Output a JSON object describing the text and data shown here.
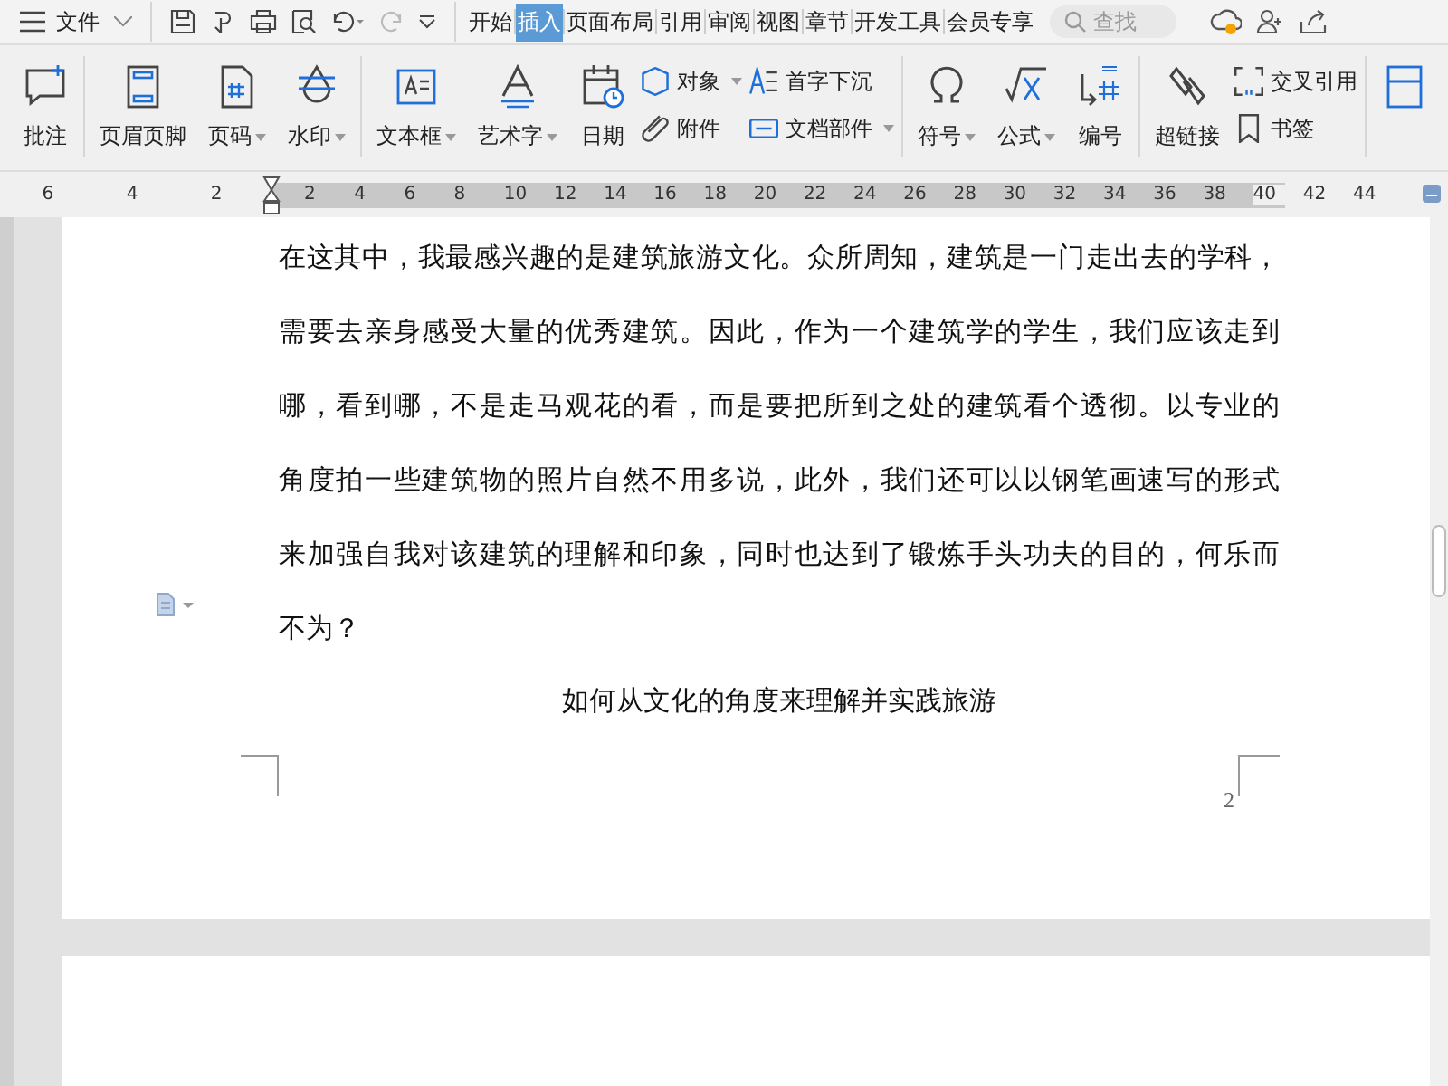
{
  "menu": {
    "file_label": "文件",
    "tabs": [
      {
        "label": "开始",
        "selected": false
      },
      {
        "label": "插入",
        "selected": true
      },
      {
        "label": "页面布局",
        "selected": false
      },
      {
        "label": "引用",
        "selected": false
      },
      {
        "label": "审阅",
        "selected": false
      },
      {
        "label": "视图",
        "selected": false
      },
      {
        "label": "章节",
        "selected": false
      },
      {
        "label": "开发工具",
        "selected": false
      },
      {
        "label": "会员专享",
        "selected": false
      }
    ],
    "search": {
      "placeholder": "查找"
    }
  },
  "ribbon": {
    "groups": [
      {
        "items": [
          {
            "kind": "large",
            "label": "批注",
            "dropdown": false
          }
        ]
      },
      {
        "items": [
          {
            "kind": "large",
            "label": "页眉页脚",
            "dropdown": false
          },
          {
            "kind": "large",
            "label": "页码",
            "dropdown": true
          },
          {
            "kind": "large",
            "label": "水印",
            "dropdown": true
          }
        ]
      },
      {
        "items": [
          {
            "kind": "large",
            "label": "文本框",
            "dropdown": true
          },
          {
            "kind": "large",
            "label": "艺术字",
            "dropdown": true
          },
          {
            "kind": "large",
            "label": "日期",
            "dropdown": false
          },
          {
            "kind": "small",
            "label": "对象",
            "dropdown": true
          },
          {
            "kind": "small",
            "label": "附件",
            "dropdown": false
          },
          {
            "kind": "small",
            "label": "首字下沉",
            "dropdown": false
          },
          {
            "kind": "small",
            "label": "文档部件",
            "dropdown": true
          }
        ]
      },
      {
        "items": [
          {
            "kind": "large",
            "label": "符号",
            "dropdown": true
          },
          {
            "kind": "large",
            "label": "公式",
            "dropdown": true
          },
          {
            "kind": "large",
            "label": "编号",
            "dropdown": false
          }
        ]
      },
      {
        "items": [
          {
            "kind": "large",
            "label": "超链接",
            "dropdown": false
          },
          {
            "kind": "small",
            "label": "交叉引用",
            "dropdown": false
          },
          {
            "kind": "small",
            "label": "书签",
            "dropdown": false
          }
        ]
      },
      {
        "items": [
          {
            "kind": "large"
          }
        ]
      }
    ]
  },
  "ruler": {
    "left_numbers": [
      "6",
      "4",
      "2"
    ],
    "numbers": [
      "2",
      "4",
      "6",
      "8",
      "10",
      "12",
      "14",
      "16",
      "18",
      "20",
      "22",
      "24",
      "26",
      "28",
      "30",
      "32",
      "34",
      "36",
      "38",
      "40",
      "42",
      "44"
    ]
  },
  "document": {
    "paragraph_lines": [
      "在这其中，我最感兴趣的是建筑旅游文化。众所周知，建筑是一门走出去的学科，",
      "需要去亲身感受大量的优秀建筑。因此，作为一个建筑学的学生，我们应该走到",
      "哪，看到哪，不是走马观花的看，而是要把所到之处的建筑看个透彻。以专业的",
      "角度拍一些建筑物的照片自然不用多说，此外，我们还可以以钢笔画速写的形式",
      "来加强自我对该建筑的理解和印象，同时也达到了锻炼手头功夫的目的，何乐而",
      "不为？"
    ],
    "heading": "如何从文化的角度来理解并实践旅游",
    "page_number": "2"
  }
}
